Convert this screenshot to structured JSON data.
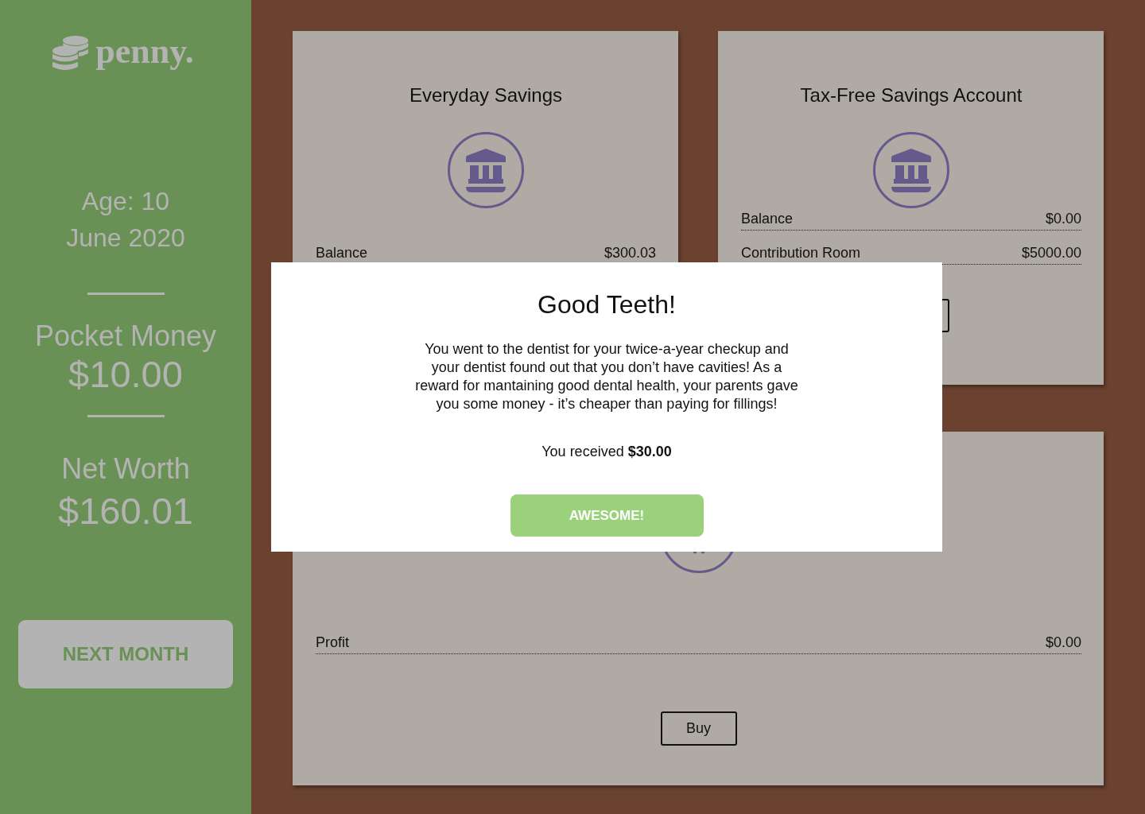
{
  "sidebar": {
    "logo": "penny.",
    "age": "Age: 10",
    "date": "June 2020",
    "stats": [
      {
        "label": "Pocket Money",
        "value": "$10.00"
      },
      {
        "label": "Net Worth",
        "value": "$160.01"
      }
    ],
    "next_button": "NEXT MONTH"
  },
  "accounts": [
    {
      "title": "Everyday Savings",
      "rows": [
        {
          "label": "Balance",
          "value": "$300.03"
        }
      ]
    },
    {
      "title": "Tax-Free Savings Account",
      "rows": [
        {
          "label": "Balance",
          "value": "$0.00"
        },
        {
          "label": "Contribution Room",
          "value": "$5000.00"
        }
      ],
      "button_covered": true
    },
    {
      "rows": [
        {
          "label": "Profit",
          "value": "$0.00"
        }
      ],
      "button": "Buy"
    }
  ],
  "modal": {
    "title": "Good Teeth!",
    "message": "You went to the dentist for your twice-a-year checkup and your dentist found out that you don’t have cavities! As a reward for mantaining good dental health, your parents gave you some money - it’s cheaper than paying for fillings!",
    "reward": "You received **$30.00**",
    "button": "AWESOME!"
  }
}
